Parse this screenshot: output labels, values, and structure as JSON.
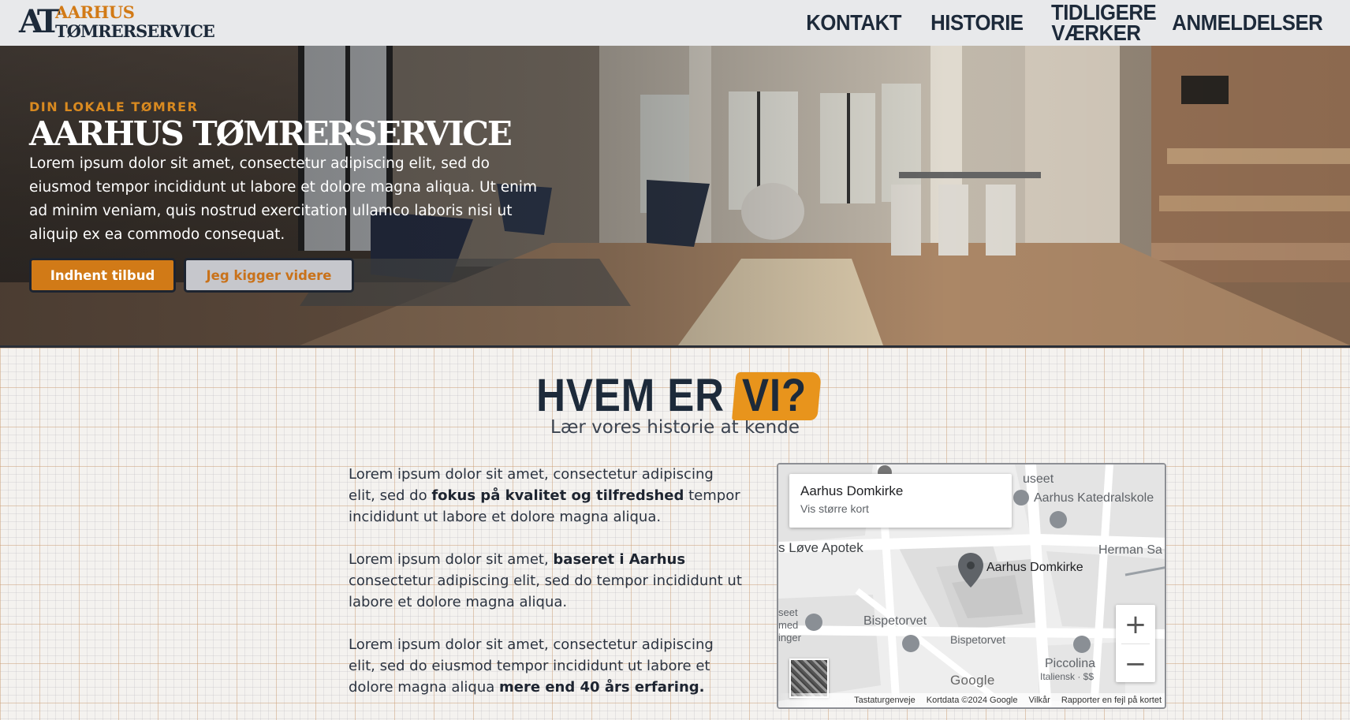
{
  "header": {
    "logo": {
      "mark": "AT",
      "line1": "AARHUS",
      "line2": "TØMRERSERVICE"
    },
    "nav": [
      {
        "label": "KONTAKT"
      },
      {
        "label": "HISTORIE"
      },
      {
        "label": "TIDLIGERE VÆRKER"
      },
      {
        "label": "ANMELDELSER"
      }
    ]
  },
  "hero": {
    "kicker": "DIN LOKALE TØMRER",
    "title": "AARHUS TØMRERSERVICE",
    "text": "Lorem ipsum dolor sit amet, consectetur adipiscing elit, sed do eiusmod tempor incididunt ut labore et dolore magna aliqua. Ut enim ad minim veniam, quis nostrud exercitation ullamco laboris nisi ut aliquip ex ea commodo consequat.",
    "primary_button": "Indhent tilbud",
    "secondary_button": "Jeg kigger videre"
  },
  "about": {
    "title_part1": "HVEM ER",
    "title_part2": "VI?",
    "subtitle": "Lær vores historie at kende",
    "p1_a": "Lorem ipsum dolor sit amet, consectetur adipiscing elit, sed do ",
    "p1_b": "fokus på kvalitet og tilfredshed",
    "p1_c": " tempor incididunt ut labore et dolore magna aliqua.",
    "p2_a": "Lorem ipsum dolor sit amet, ",
    "p2_b": "baseret i Aarhus",
    "p2_c": " consectetur adipiscing elit, sed do tempor incididunt ut labore et dolore magna aliqua.",
    "p3_a": "Lorem ipsum dolor sit amet, consectetur adipiscing elit, sed do eiusmod tempor incididunt ut labore et dolore magna aliqua ",
    "p3_b": "mere end 40 års erfaring."
  },
  "map": {
    "card_title": "Aarhus Domkirke",
    "card_link": "Vis større kort",
    "labels": {
      "useet": "useet",
      "katedralskole": "Aarhus Katedralskole",
      "apotek": "s Løve Apotek",
      "herman": "Herman Sa",
      "domkirke": "Aarhus Domkirke",
      "seet": "seet",
      "med": "med",
      "inger": "inger",
      "bispetorvet1": "Bispetorvet",
      "bispetorvet2": "Bispetorvet",
      "piccolina": "Piccolina",
      "italiensk": "Italiensk · $$"
    },
    "zoom_in": "+",
    "zoom_out": "−",
    "google": "Google",
    "footer": {
      "shortcuts": "Tastaturgenveje",
      "data": "Kortdata ©2024 Google",
      "terms": "Vilkår",
      "report": "Rapporter en fejl på kortet"
    }
  },
  "colors": {
    "accent": "#d17a17",
    "navy": "#1d2a3a",
    "header_bg": "#e8e9eb"
  }
}
